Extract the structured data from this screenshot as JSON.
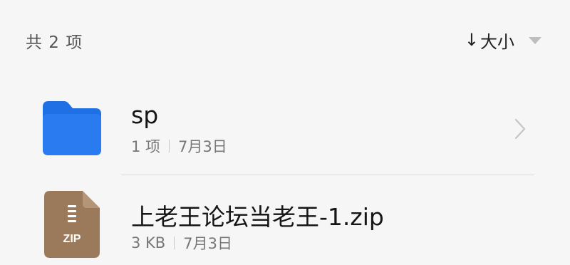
{
  "header": {
    "count_text": "共 2 项",
    "sort_arrow": "↓",
    "sort_label": "大小"
  },
  "items": [
    {
      "name": "sp",
      "meta_left": "1 项",
      "meta_right": "7月3日",
      "icon": "folder-icon",
      "color": "#1f6fe5",
      "has_chevron": true
    },
    {
      "name": "上老王论坛当老王-1.zip",
      "meta_left": "3 KB",
      "meta_right": "7月3日",
      "icon": "zip-file-icon",
      "color": "#9b7a5c",
      "icon_text": "ZIP",
      "has_chevron": false
    }
  ]
}
